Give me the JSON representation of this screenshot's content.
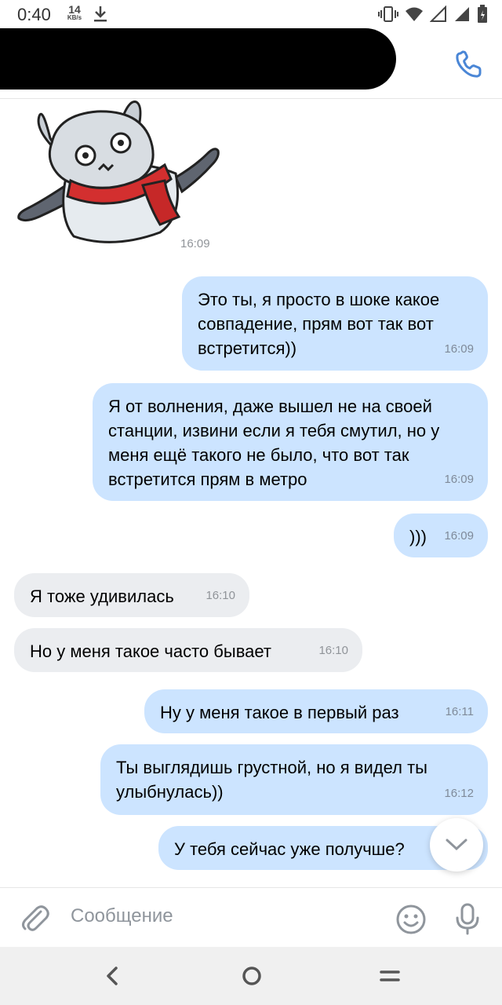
{
  "status_bar": {
    "time": "0:40",
    "net_speed_value": "14",
    "net_speed_unit": "KB/s"
  },
  "header": {
    "call_icon": "phone-icon"
  },
  "chat": {
    "sticker_time": "16:09",
    "messages": [
      {
        "dir": "out",
        "text": "Это ты, я просто в шоке какое совпадение, прям вот так вот встретится))",
        "time": "16:09"
      },
      {
        "dir": "out",
        "text": "Я от волнения, даже вышел не на своей станции, извини если я тебя смутил, но у меня ещё такого не было, что вот так встретится прям в метро",
        "time": "16:09"
      },
      {
        "dir": "out",
        "text": ")))",
        "time": "16:09"
      },
      {
        "dir": "in",
        "text": "Я тоже удивилась",
        "time": "16:10"
      },
      {
        "dir": "in",
        "text": "Но у меня такое часто бывает",
        "time": "16:10"
      },
      {
        "dir": "out",
        "text": "Ну у меня такое в первый раз",
        "time": "16:11"
      },
      {
        "dir": "out",
        "text": "Ты выглядишь грустной, но я видел ты улыбнулась))",
        "time": "16:12"
      },
      {
        "dir": "out",
        "text": "У тебя сейчас уже получше?",
        "time": ""
      }
    ]
  },
  "composer": {
    "placeholder": "Сообщение"
  },
  "colors": {
    "outgoing_bubble": "#cce4ff",
    "incoming_bubble": "#ebedf0",
    "accent": "#4a86d6"
  }
}
